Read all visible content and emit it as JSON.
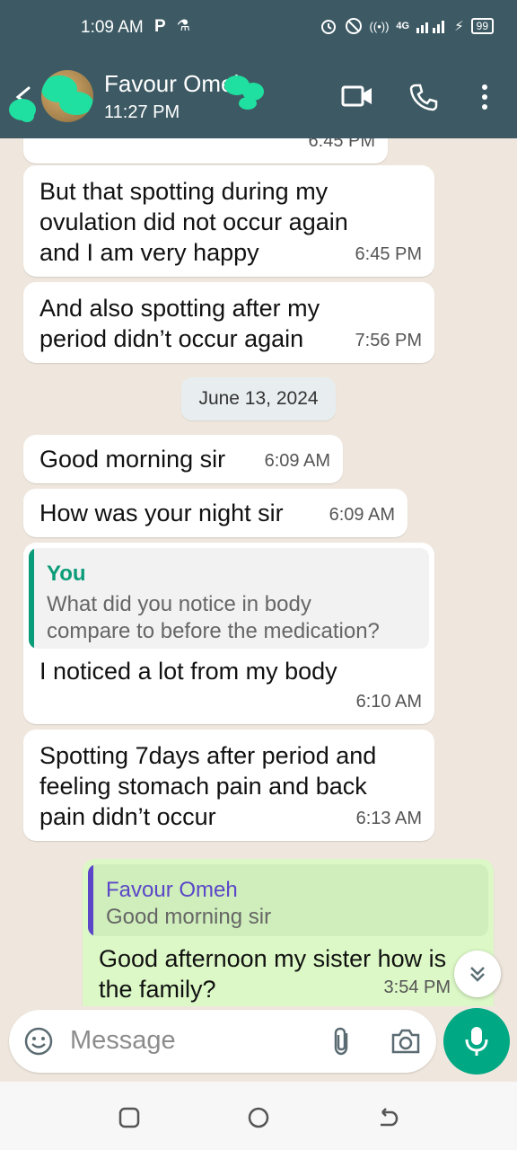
{
  "status_bar": {
    "time": "1:09 AM",
    "left_icons": [
      "P",
      "⚗"
    ],
    "network": "4G",
    "battery": "99"
  },
  "header": {
    "contact_name": "Favour Omeh",
    "subtitle": "11:27 PM",
    "icons": [
      "back-arrow-icon",
      "avatar",
      "video-call-icon",
      "phone-call-icon",
      "more-vert-icon"
    ],
    "accent_color": "#3d5a64"
  },
  "messages": [
    {
      "id": "m0",
      "direction": "in",
      "text": "",
      "time": "6:45 PM"
    },
    {
      "id": "m1",
      "direction": "in",
      "text": "But that spotting during my\novulation did not occur again\nand I am very happy",
      "time": "6:45 PM"
    },
    {
      "id": "m2",
      "direction": "in",
      "text": "And also spotting after my\nperiod didn’t occur again",
      "time": "7:56 PM"
    },
    {
      "id": "m3",
      "direction": "in",
      "text": "Good morning sir",
      "time": "6:09 AM"
    },
    {
      "id": "m4",
      "direction": "in",
      "text": "How was your night sir",
      "time": "6:09 AM"
    },
    {
      "id": "m5",
      "direction": "in",
      "text": "I noticed a lot from my body",
      "time": "6:10 AM",
      "quote": {
        "author": "You",
        "text": "What did you notice in body\ncompare to before the medication?",
        "color": "#0a9c78"
      }
    },
    {
      "id": "m6",
      "direction": "in",
      "text": "Spotting 7days after period and\nfeeling stomach pain and back\npain didn’t occur",
      "time": "6:13 AM"
    },
    {
      "id": "m7",
      "direction": "out",
      "text": "Good afternoon my sister how is\nthe family?",
      "time": "3:54 PM",
      "quote": {
        "author": "Favour Omeh",
        "text": "Good morning sir",
        "color": "#5b46c9"
      }
    }
  ],
  "date_separator": "June 13, 2024",
  "input": {
    "placeholder": "Message",
    "icons": [
      "emoji-icon",
      "attach-icon",
      "camera-icon",
      "mic-icon"
    ]
  },
  "scroll_down_icon": "double-chevron-down-icon",
  "nav": [
    "recent-apps-icon",
    "home-icon",
    "back-icon"
  ],
  "colors": {
    "accent": "#00a884",
    "header": "#3d5a64",
    "outgoing_bubble": "#dcf8c6"
  }
}
